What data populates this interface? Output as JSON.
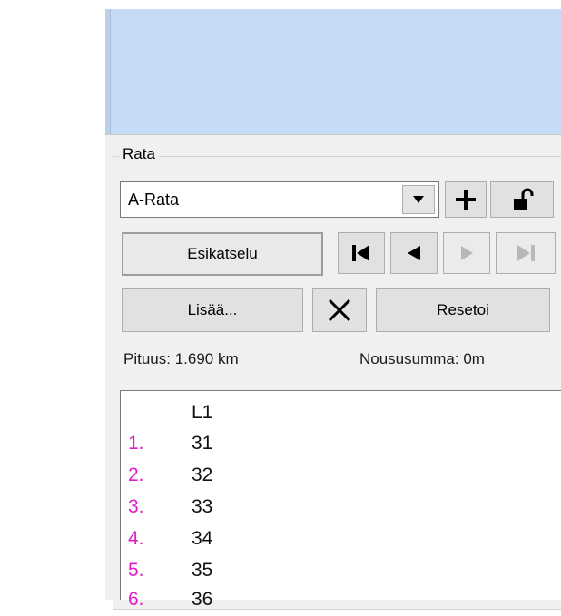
{
  "group": {
    "title": "Rata"
  },
  "course_select": {
    "value": "A-Rata"
  },
  "buttons": {
    "preview": "Esikatselu",
    "add_more": "Lisää...",
    "reset": "Resetoi"
  },
  "icons": {
    "dropdown": "chevron-down-icon",
    "add": "plus-icon",
    "lock": "unlock-icon",
    "first": "skip-first-icon",
    "prev": "step-back-icon",
    "play": "play-icon",
    "last": "skip-last-icon",
    "delete": "close-icon"
  },
  "info": {
    "length": "Pituus: 1.690 km",
    "climb": "Noususumma: 0m"
  },
  "controls": {
    "header": "L1",
    "items": [
      {
        "num": "1.",
        "code": "31"
      },
      {
        "num": "2.",
        "code": "32"
      },
      {
        "num": "3.",
        "code": "33"
      },
      {
        "num": "4.",
        "code": "34"
      },
      {
        "num": "5.",
        "code": "35"
      },
      {
        "num": "6.",
        "code": "36"
      }
    ]
  },
  "colors": {
    "top_panel": "#c6dbf7",
    "list_number": "#e01ec8",
    "window_bg": "#f0f0f0"
  }
}
